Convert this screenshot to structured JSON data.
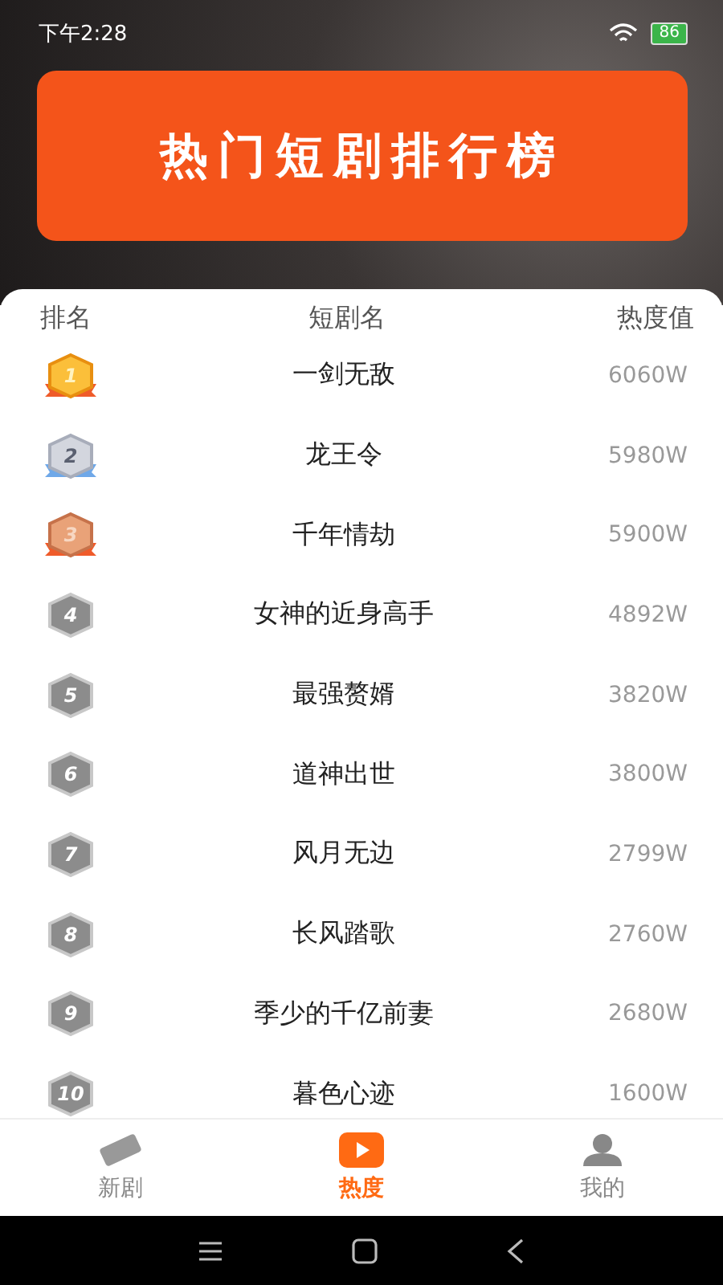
{
  "status_bar": {
    "time": "下午2:28",
    "battery": "86"
  },
  "banner": {
    "title": "热门短剧排行榜"
  },
  "table": {
    "columns": [
      "排名",
      "短剧名",
      "热度值"
    ],
    "rows": [
      {
        "rank": "1",
        "kind": "gold",
        "title": "一剑无敌",
        "heat": "6060W"
      },
      {
        "rank": "2",
        "kind": "silver",
        "title": "龙王令",
        "heat": "5980W"
      },
      {
        "rank": "3",
        "kind": "bronze",
        "title": "千年情劫",
        "heat": "5900W"
      },
      {
        "rank": "4",
        "kind": "plain",
        "title": "女神的近身高手",
        "heat": "4892W"
      },
      {
        "rank": "5",
        "kind": "plain",
        "title": "最强赘婿",
        "heat": "3820W"
      },
      {
        "rank": "6",
        "kind": "plain",
        "title": "道神出世",
        "heat": "3800W"
      },
      {
        "rank": "7",
        "kind": "plain",
        "title": "风月无边",
        "heat": "2799W"
      },
      {
        "rank": "8",
        "kind": "plain",
        "title": "长风踏歌",
        "heat": "2760W"
      },
      {
        "rank": "9",
        "kind": "plain",
        "title": "季少的千亿前妻",
        "heat": "2680W"
      },
      {
        "rank": "10",
        "kind": "plain",
        "title": "暮色心迹",
        "heat": "1600W"
      }
    ]
  },
  "tab_bar": [
    {
      "label": "新剧",
      "kind": "new",
      "selected": false
    },
    {
      "label": "热度",
      "kind": "play",
      "selected": true
    },
    {
      "label": "我的",
      "kind": "user",
      "selected": false
    }
  ]
}
